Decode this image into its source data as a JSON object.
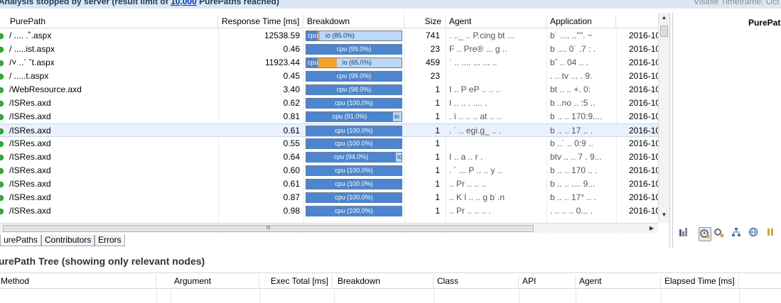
{
  "topbar": {
    "status_prefix": "Analysis stopped by server (result limit of ",
    "status_link": "10,000",
    "status_suffix": " PurePaths reached)",
    "timeframe_label": "Visible Timeframe: Oct"
  },
  "table": {
    "columns": [
      "PurePath",
      "Response Time [ms]",
      "Breakdown",
      "Size",
      "Agent",
      "Application",
      ""
    ],
    "rows": [
      {
        "purepath": "/ .... .˚.aspx",
        "response": "12538.59",
        "cpu": 3,
        "io": 85.0,
        "other": 0,
        "label": "io (85.0%)",
        "cpu_label": "cpu",
        "size": "741",
        "agent": ". .._ .. P.cing bt ...",
        "app": "b˙ .... ..'\"'.  ~",
        "date": "2016-10"
      },
      {
        "purepath": "/  .....ist.aspx",
        "response": "0.46",
        "cpu": 99.0,
        "io": 0,
        "other": 0,
        "label": "cpu (99.0%)",
        "size": "23",
        "agent": "F .. Pre® ...  g ..",
        "app": "b .... 0˙ .7 : .",
        "date": "2016-10"
      },
      {
        "purepath": "/˅ ..´ ˇt.aspx",
        "response": "11923.44",
        "cpu": 3,
        "io": 65.0,
        "other": 20,
        "label": "io (65.0%)",
        "cpu_label": "cpu",
        "size": "459",
        "agent": "˙ .. .... ... ... ..",
        "app": "bˇ  .. 04 .. .",
        "date": "2016-10"
      },
      {
        "purepath": "/ .....t.aspx",
        "response": "0.45",
        "cpu": 99.0,
        "io": 0,
        "other": 0,
        "label": "cpu (99.0%)",
        "size": "23",
        "agent": "",
        "app": ". .. tv ...  . 9.",
        "date": "2016-10"
      },
      {
        "purepath": "/WebResource.axd",
        "response": "3.40",
        "cpu": 98.0,
        "io": 0,
        "other": 0,
        "label": "cpu (98.0%)",
        "size": "1",
        "agent": "I .. P eP .. ..  ..",
        "app": "bt .. .. +. 0:",
        "date": "2016-10"
      },
      {
        "purepath": "/ISRes.axd",
        "response": "0.62",
        "cpu": 100.0,
        "io": 0,
        "other": 0,
        "label": "cpu (100.0%)",
        "size": "1",
        "agent": "I .. ..  . ....  .",
        "app": "b ..no .. :5 ..",
        "date": "2016-10"
      },
      {
        "purepath": "/ISRes.axd",
        "response": "0.81",
        "cpu": 91.0,
        "io": 9.0,
        "other": 0,
        "label": "cpu (91.0%)",
        "io_label": "io",
        "size": "1",
        "agent": ". ì .. .. .. at ..  ..",
        "app": "b .. .. 170:9....",
        "date": "2016-10"
      },
      {
        "purepath": "/ISRes.axd",
        "response": "0.61",
        "cpu": 100.0,
        "io": 0,
        "other": 0,
        "label": "cpu (100.0%)",
        "size": "1",
        "agent": ". ˙ .. egi.g_ .. .",
        "app": "b .. .. 17 .. .",
        "date": "2016-10"
      },
      {
        "purepath": "/ISRes.axd",
        "response": "0.55",
        "cpu": 100.0,
        "io": 0,
        "other": 0,
        "label": "cpu (100.0%)",
        "size": "1",
        "agent": "",
        "app": "b ..˙ .. 0:9 ..",
        "date": "2016-10"
      },
      {
        "purepath": "/ISRes.axd",
        "response": "0.64",
        "cpu": 94.0,
        "io": 6.0,
        "other": 0,
        "label": "cpu (94.0%)",
        "io_label": "io",
        "size": "1",
        "agent": "I ..    a ..   r .",
        "app": "btv .. .. 7 . 9...",
        "date": "2016-10"
      },
      {
        "purepath": "/ISRes.axd",
        "response": "0.60",
        "cpu": 100.0,
        "io": 0,
        "other": 0,
        "label": "cpu (100.0%)",
        "size": "1",
        "agent": ". ´ ... P .. .. y ..",
        "app": "b .. .. 170 .. .",
        "date": "2016-10"
      },
      {
        "purepath": "/ISRes.axd",
        "response": "0.61",
        "cpu": 100.0,
        "io": 0,
        "other": 0,
        "label": "cpu (100.0%)",
        "size": "1",
        "agent": ".. Pr .. ..  ..",
        "app": "b .. .. ....  9...",
        "date": "2016-10"
      },
      {
        "purepath": "/ISRes.axd",
        "response": "0.87",
        "cpu": 100.0,
        "io": 0,
        "other": 0,
        "label": "cpu (100.0%)",
        "size": "1",
        "agent": ".. K l .. .. g b˙.n",
        "app": "b .. .. 17° .. .",
        "date": "2016-10"
      },
      {
        "purepath": "/ISRes.axd",
        "response": "0.98",
        "cpu": 100.0,
        "io": 0,
        "other": 0,
        "label": "cpu (100.0%)",
        "size": "1",
        "agent": ".. Pr .. .. ..  .",
        "app": ". .. .. .. 0... .",
        "date": "2016-10"
      }
    ],
    "hscroll_grip": "III"
  },
  "tabs": [
    {
      "label": "urePaths",
      "active": true
    },
    {
      "label": "Contributors",
      "active": false
    },
    {
      "label": "Errors",
      "active": false
    }
  ],
  "side": {
    "title": "PurePatl",
    "toolbar_icons": [
      "chart-icon",
      "clock-gear-icon",
      "gears-icon",
      "tree-icon",
      "globe-icon",
      "pause-icon"
    ]
  },
  "tree": {
    "title": "urePath Tree (showing only relevant nodes)",
    "columns": [
      "Method",
      "Argument",
      "Exec Total [ms]",
      "Breakdown",
      "Class",
      "API",
      "Agent",
      "Elapsed Time [ms]"
    ]
  },
  "colors": {
    "cpu": "#4d86d0",
    "io": "#bcd8f7",
    "other": "#f5a22a",
    "ok_status": "#2fb32f",
    "link": "#0033cc"
  }
}
